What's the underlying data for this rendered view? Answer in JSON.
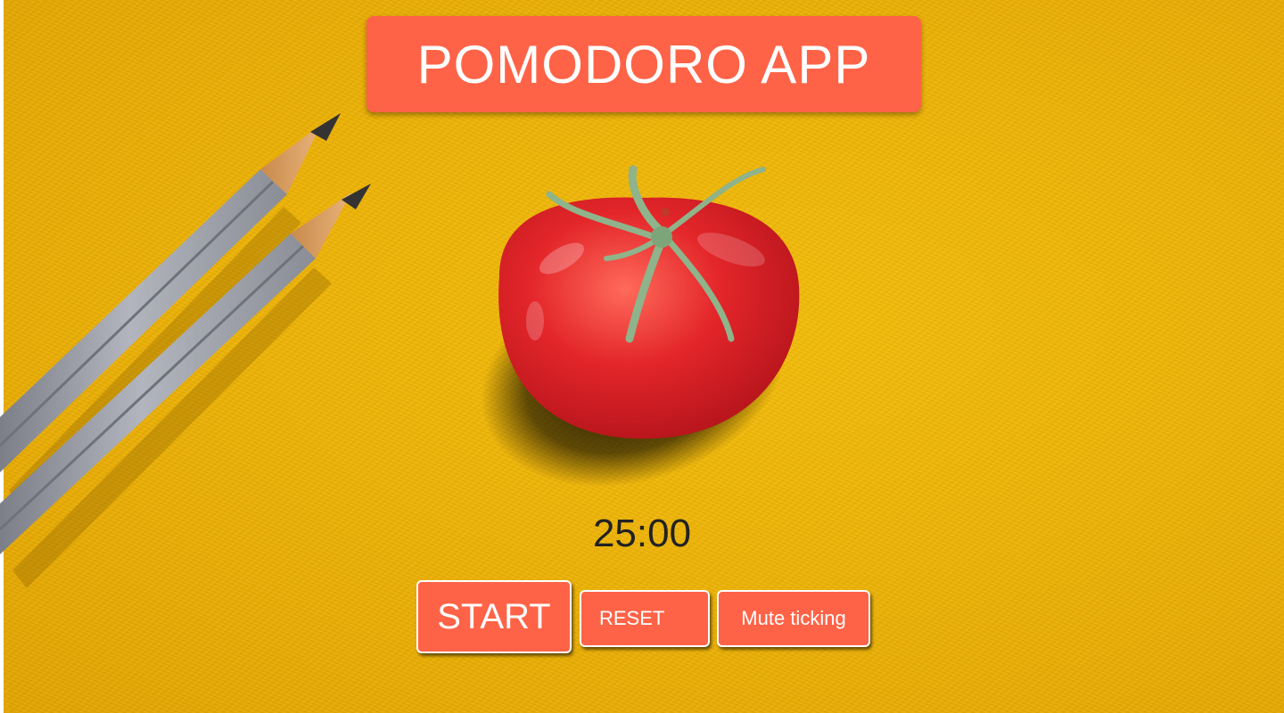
{
  "app": {
    "title": "POMODORO APP"
  },
  "timer": {
    "display": "25:00"
  },
  "controls": {
    "start_label": "START",
    "reset_label": "RESET",
    "mute_label": "Mute ticking"
  },
  "theme": {
    "background": "#eeb305",
    "accent": "#ff6347",
    "text_on_accent": "#ffffff",
    "timer_text": "#222222"
  },
  "icons": {
    "hero": "tomato-icon",
    "decoration": "pencil-icon"
  }
}
